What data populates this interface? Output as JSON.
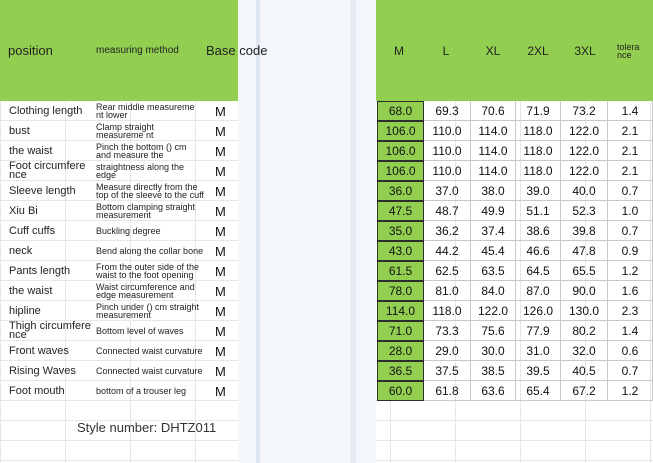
{
  "header": {
    "position": "position",
    "measuring_method": "measuring method",
    "base_code": "Base code",
    "sizes": [
      "M",
      "L",
      "XL",
      "2XL",
      "3XL"
    ],
    "tolerance": "tolera nce"
  },
  "rows": [
    {
      "position": "Clothing length",
      "method": "Rear middle measureme nt lower",
      "base": "M",
      "values": [
        "68.0",
        "69.3",
        "70.6",
        "71.9",
        "73.2"
      ],
      "tol": "1.4"
    },
    {
      "position": "bust",
      "method": "Clamp straight measureme nt",
      "base": "M",
      "values": [
        "106.0",
        "110.0",
        "114.0",
        "118.0",
        "122.0"
      ],
      "tol": "2.1"
    },
    {
      "position": "the waist",
      "method": "Pinch the bottom () cm and measure the",
      "base": "M",
      "values": [
        "106.0",
        "110.0",
        "114.0",
        "118.0",
        "122.0"
      ],
      "tol": "2.1"
    },
    {
      "position": "Foot circumfere nce",
      "method": "straightness along the edge",
      "base": "M",
      "values": [
        "106.0",
        "110.0",
        "114.0",
        "118.0",
        "122.0"
      ],
      "tol": "2.1"
    },
    {
      "position": "Sleeve length",
      "method": "Measure directly from the top of the sleeve to the cuff",
      "base": "M",
      "values": [
        "36.0",
        "37.0",
        "38.0",
        "39.0",
        "40.0"
      ],
      "tol": "0.7"
    },
    {
      "position": "Xiu Bi",
      "method": "Bottom clamping straight measurement",
      "base": "M",
      "values": [
        "47.5",
        "48.7",
        "49.9",
        "51.1",
        "52.3"
      ],
      "tol": "1.0"
    },
    {
      "position": "Cuff cuffs",
      "method": "Buckling degree",
      "base": "M",
      "values": [
        "35.0",
        "36.2",
        "37.4",
        "38.6",
        "39.8"
      ],
      "tol": "0.7"
    },
    {
      "position": "neck",
      "method": "Bend along the collar bone",
      "base": "M",
      "values": [
        "43.0",
        "44.2",
        "45.4",
        "46.6",
        "47.8"
      ],
      "tol": "0.9"
    },
    {
      "position": "Pants length",
      "method": "From the outer side of the waist to the foot opening",
      "base": "M",
      "values": [
        "61.5",
        "62.5",
        "63.5",
        "64.5",
        "65.5"
      ],
      "tol": "1.2"
    },
    {
      "position": "the waist",
      "method": "Waist circumference and edge measurement",
      "base": "M",
      "values": [
        "78.0",
        "81.0",
        "84.0",
        "87.0",
        "90.0"
      ],
      "tol": "1.6"
    },
    {
      "position": "hipline",
      "method": "Pinch under () cm straight measurement",
      "base": "M",
      "values": [
        "114.0",
        "118.0",
        "122.0",
        "126.0",
        "130.0"
      ],
      "tol": "2.3"
    },
    {
      "position": "Thigh circumfere nce",
      "method": "Bottom level of waves",
      "base": "M",
      "values": [
        "71.0",
        "73.3",
        "75.6",
        "77.9",
        "80.2"
      ],
      "tol": "1.4"
    },
    {
      "position": "Front waves",
      "method": "Connected waist curvature",
      "base": "M",
      "values": [
        "28.0",
        "29.0",
        "30.0",
        "31.0",
        "32.0"
      ],
      "tol": "0.6"
    },
    {
      "position": "Rising Waves",
      "method": "Connected waist curvature",
      "base": "M",
      "values": [
        "36.5",
        "37.5",
        "38.5",
        "39.5",
        "40.5"
      ],
      "tol": "0.7"
    },
    {
      "position": "Foot mouth",
      "method": "bottom of a trouser leg",
      "base": "M",
      "values": [
        "60.0",
        "61.8",
        "63.6",
        "65.4",
        "67.2"
      ],
      "tol": "1.2"
    }
  ],
  "footer": {
    "style_number": "Style number: DHTZ011"
  },
  "colors": {
    "header_green": "#92cf50",
    "grid": "#c8c8c8"
  }
}
